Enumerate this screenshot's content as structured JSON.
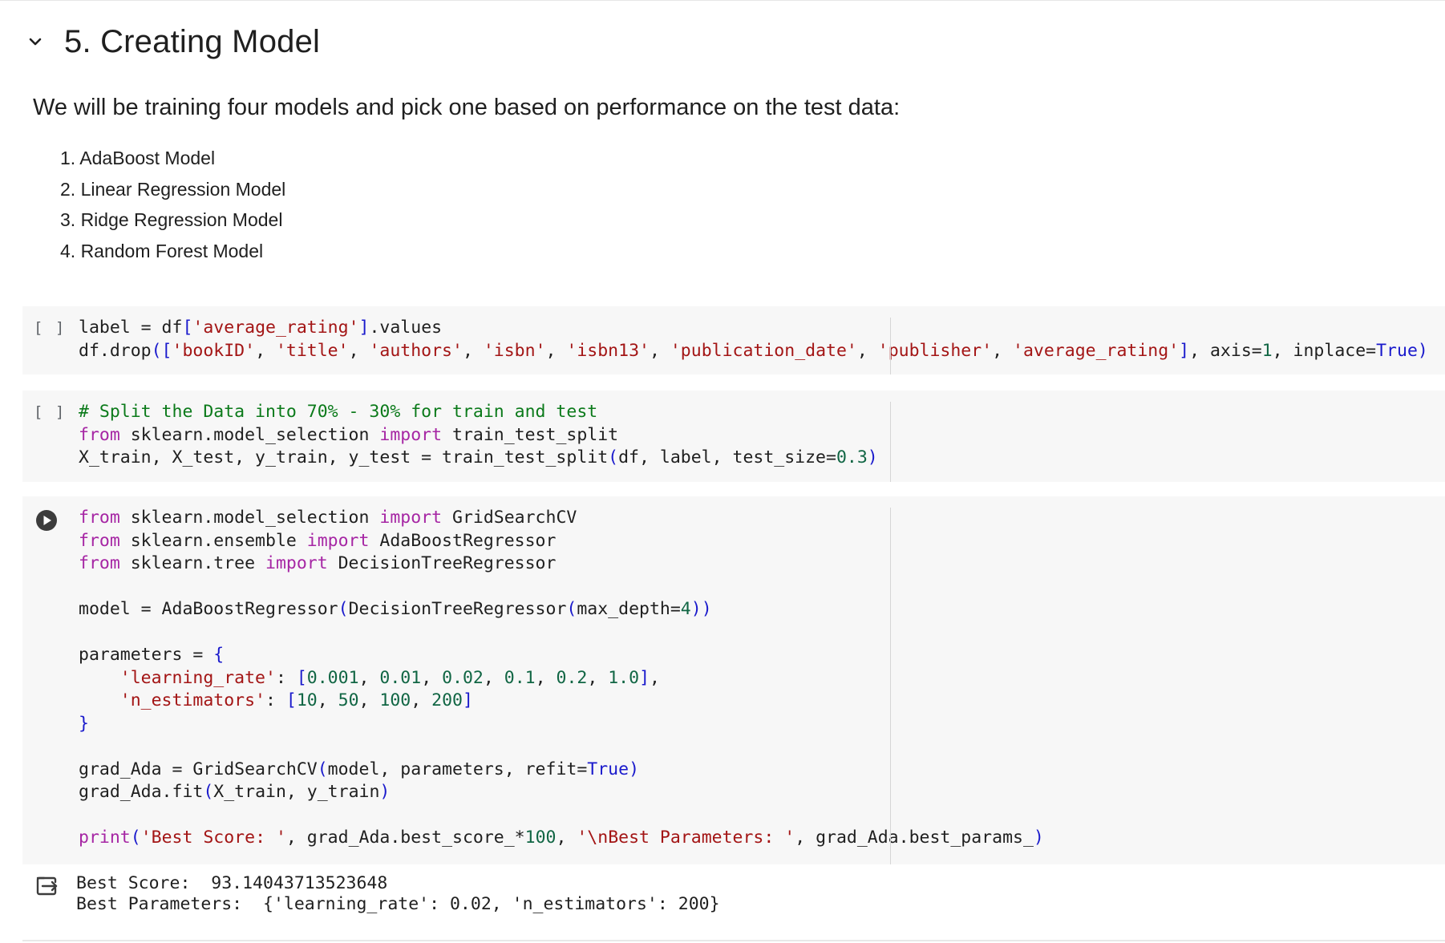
{
  "section": {
    "title": "5. Creating Model"
  },
  "text_cell": {
    "intro": "We will be training four models and pick one based on performance on the test data:",
    "models": [
      "1. AdaBoost Model",
      "2. Linear Regression Model",
      "3. Ridge Regression Model",
      "4. Random Forest Model"
    ]
  },
  "cells": [
    {
      "exec_label": "[ ]",
      "lines": [
        [
          [
            "",
            "label = df"
          ],
          [
            "br",
            "["
          ],
          [
            "st",
            "'average_rating'"
          ],
          [
            "br",
            "]"
          ],
          [
            "",
            ".values"
          ]
        ],
        [
          [
            "",
            "df.drop"
          ],
          [
            "br",
            "(["
          ],
          [
            "st",
            "'bookID'"
          ],
          [
            "",
            ", "
          ],
          [
            "st",
            "'title'"
          ],
          [
            "",
            ", "
          ],
          [
            "st",
            "'authors'"
          ],
          [
            "",
            ", "
          ],
          [
            "st",
            "'isbn'"
          ],
          [
            "",
            ", "
          ],
          [
            "st",
            "'isbn13'"
          ],
          [
            "",
            ", "
          ],
          [
            "st",
            "'publication_date'"
          ],
          [
            "",
            ", "
          ],
          [
            "st",
            "'publisher'"
          ],
          [
            "",
            ", "
          ],
          [
            "st",
            "'average_rating'"
          ],
          [
            "br",
            "]"
          ],
          [
            "",
            ", axis="
          ],
          [
            "nm",
            "1"
          ],
          [
            "",
            ", inplace="
          ],
          [
            "bl",
            "True"
          ],
          [
            "br",
            ")"
          ]
        ]
      ]
    },
    {
      "exec_label": "[ ]",
      "lines": [
        [
          [
            "cm",
            "# Split the Data into 70% - 30% for train and test"
          ]
        ],
        [
          [
            "kw",
            "from"
          ],
          [
            "",
            " sklearn.model_selection "
          ],
          [
            "kw",
            "import"
          ],
          [
            "",
            " train_test_split"
          ]
        ],
        [
          [
            "",
            "X_train, X_test, y_train, y_test = train_test_split"
          ],
          [
            "br",
            "("
          ],
          [
            "",
            "df, label, test_size="
          ],
          [
            "nm",
            "0.3"
          ],
          [
            "br",
            ")"
          ]
        ]
      ]
    },
    {
      "exec_label": "",
      "lines": [
        [
          [
            "kw",
            "from"
          ],
          [
            "",
            " sklearn.model_selection "
          ],
          [
            "kw",
            "import"
          ],
          [
            "",
            " GridSearchCV"
          ]
        ],
        [
          [
            "kw",
            "from"
          ],
          [
            "",
            " sklearn.ensemble "
          ],
          [
            "kw",
            "import"
          ],
          [
            "",
            " AdaBoostRegressor"
          ]
        ],
        [
          [
            "kw",
            "from"
          ],
          [
            "",
            " sklearn.tree "
          ],
          [
            "kw",
            "import"
          ],
          [
            "",
            " DecisionTreeRegressor"
          ]
        ],
        [],
        [
          [
            "",
            "model = AdaBoostRegressor"
          ],
          [
            "br",
            "("
          ],
          [
            "",
            "DecisionTreeRegressor"
          ],
          [
            "br",
            "("
          ],
          [
            "",
            "max_depth="
          ],
          [
            "nm",
            "4"
          ],
          [
            "br",
            "))"
          ]
        ],
        [],
        [
          [
            "",
            "parameters = "
          ],
          [
            "br",
            "{"
          ]
        ],
        [
          [
            "",
            "    "
          ],
          [
            "st",
            "'learning_rate'"
          ],
          [
            "",
            ": "
          ],
          [
            "br",
            "["
          ],
          [
            "nm",
            "0.001"
          ],
          [
            "",
            ", "
          ],
          [
            "nm",
            "0.01"
          ],
          [
            "",
            ", "
          ],
          [
            "nm",
            "0.02"
          ],
          [
            "",
            ", "
          ],
          [
            "nm",
            "0.1"
          ],
          [
            "",
            ", "
          ],
          [
            "nm",
            "0.2"
          ],
          [
            "",
            ", "
          ],
          [
            "nm",
            "1.0"
          ],
          [
            "br",
            "]"
          ],
          [
            "",
            ","
          ]
        ],
        [
          [
            "",
            "    "
          ],
          [
            "st",
            "'n_estimators'"
          ],
          [
            "",
            ": "
          ],
          [
            "br",
            "["
          ],
          [
            "nm",
            "10"
          ],
          [
            "",
            ", "
          ],
          [
            "nm",
            "50"
          ],
          [
            "",
            ", "
          ],
          [
            "nm",
            "100"
          ],
          [
            "",
            ", "
          ],
          [
            "nm",
            "200"
          ],
          [
            "br",
            "]"
          ]
        ],
        [
          [
            "br",
            "}"
          ]
        ],
        [],
        [
          [
            "",
            "grad_Ada = GridSearchCV"
          ],
          [
            "br",
            "("
          ],
          [
            "",
            "model, parameters, refit="
          ],
          [
            "bl",
            "True"
          ],
          [
            "br",
            ")"
          ]
        ],
        [
          [
            "",
            "grad_Ada.fit"
          ],
          [
            "br",
            "("
          ],
          [
            "",
            "X_train, y_train"
          ],
          [
            "br",
            ")"
          ]
        ],
        [],
        [
          [
            "fn",
            "print"
          ],
          [
            "br",
            "("
          ],
          [
            "st",
            "'Best Score: '"
          ],
          [
            "",
            ", grad_Ada.best_score_*"
          ],
          [
            "nm",
            "100"
          ],
          [
            "",
            ", "
          ],
          [
            "st",
            "'\\nBest Parameters: '"
          ],
          [
            "",
            ", grad_Ada.best_params_"
          ],
          [
            "br",
            ")"
          ]
        ]
      ]
    }
  ],
  "output": {
    "line1": "Best Score:  93.14043713523648",
    "line2": "Best Parameters:  {'learning_rate': 0.02, 'n_estimators': 200}"
  },
  "icons": {
    "collapse": "chevron-down-icon",
    "run": "play-circle-icon",
    "output": "output-exit-icon"
  }
}
